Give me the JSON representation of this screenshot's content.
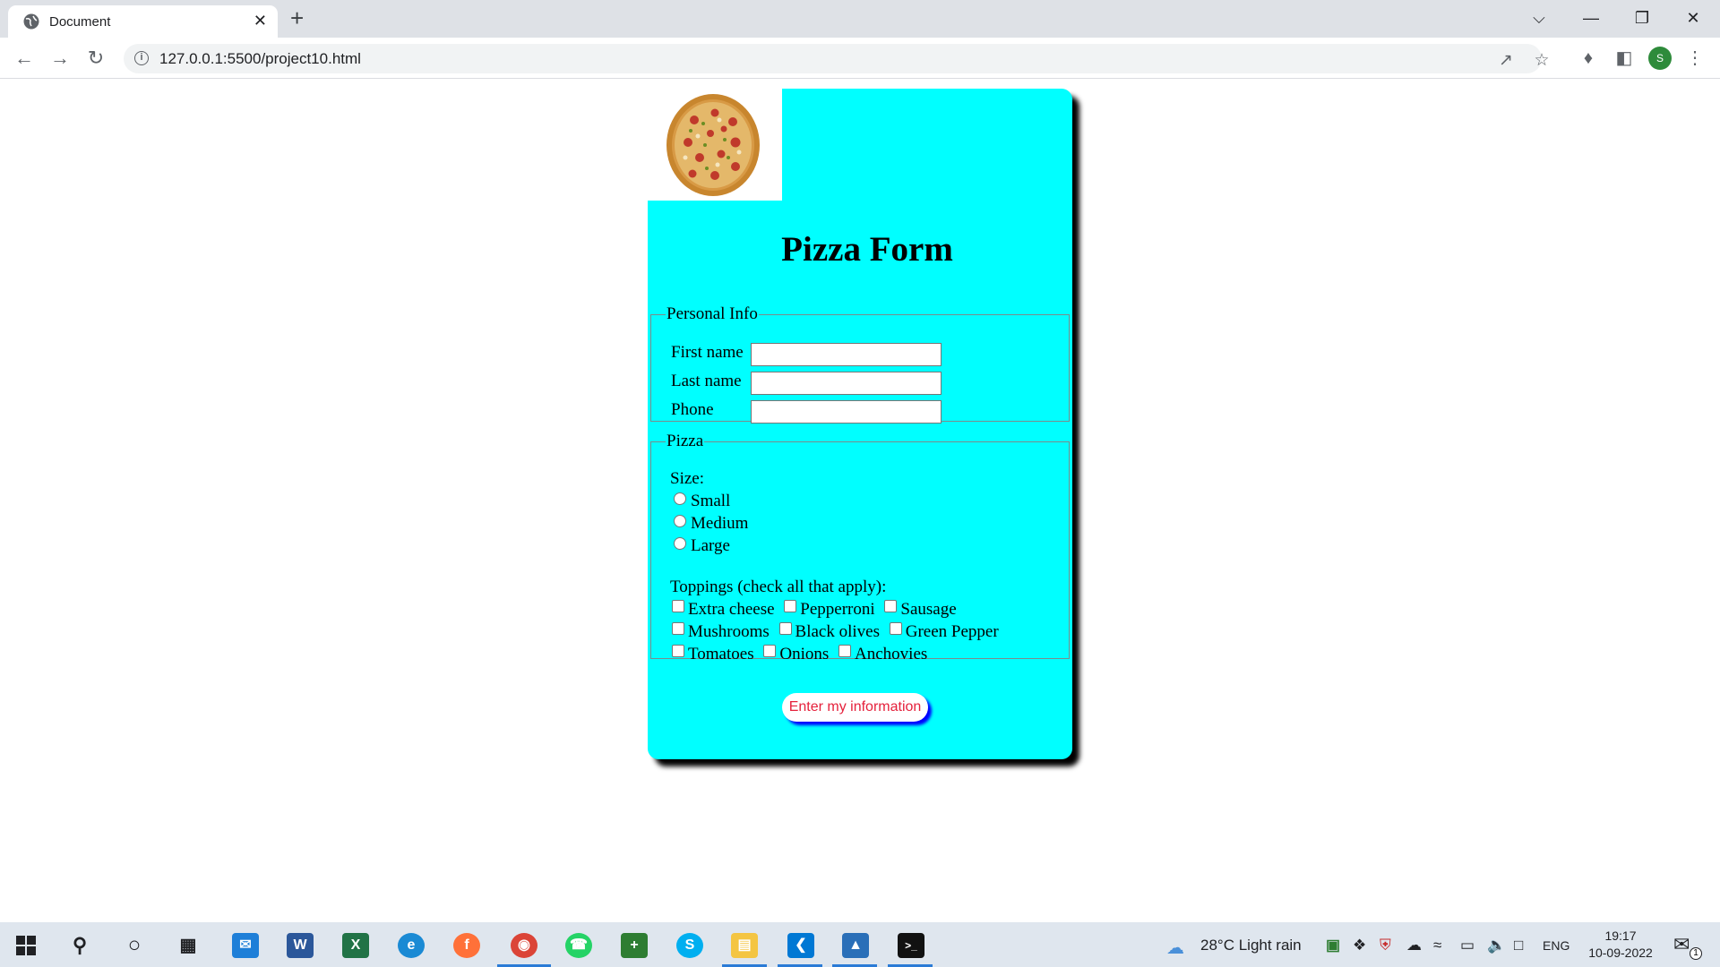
{
  "browser": {
    "tab_title": "Document",
    "tab_close": "✕",
    "new_tab": "+",
    "url": "127.0.0.1:5500/project10.html",
    "profile_initial": "S",
    "window_controls": {
      "dropdown": "⌵",
      "minimize": "—",
      "restore": "❐",
      "close": "✕"
    }
  },
  "form": {
    "heading": "Pizza Form",
    "personal": {
      "legend": "Personal Info",
      "first_name_label": "First name",
      "first_name_value": "",
      "last_name_label": "Last name",
      "last_name_value": "",
      "phone_label": "Phone",
      "phone_value": ""
    },
    "pizza": {
      "legend": "Pizza",
      "size_label": "Size:",
      "sizes": [
        "Small",
        "Medium",
        "Large"
      ],
      "toppings_label": "Toppings (check all that apply):",
      "toppings": [
        "Extra cheese",
        "Pepperroni",
        "Sausage",
        "Mushrooms",
        "Black olives",
        "Green Pepper",
        "Tomatoes",
        "Onions",
        "Anchovies"
      ]
    },
    "submit_label": "Enter my information"
  },
  "taskbar": {
    "icons": [
      "windows-start",
      "search",
      "cortana",
      "task-view",
      "mail",
      "word",
      "excel",
      "edge",
      "firefox",
      "chrome",
      "whatsapp",
      "app-plus",
      "skype",
      "file-explorer",
      "vscode",
      "photos",
      "terminal"
    ],
    "weather": "28°C  Light rain",
    "language": "ENG",
    "time": "19:17",
    "date": "10-09-2022",
    "notification_count": "1"
  },
  "colors": {
    "card_bg": "#00ffff",
    "button_text": "#e5213c",
    "button_shadow": "#0000ff",
    "tab_strip": "#dee1e6",
    "taskbar": "#dfe6ee"
  }
}
